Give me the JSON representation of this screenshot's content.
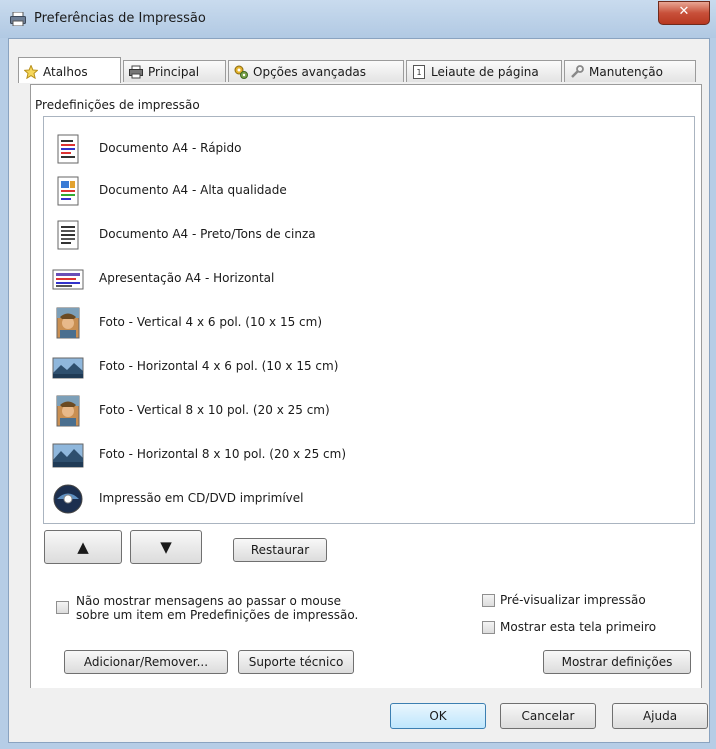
{
  "window": {
    "title": "Preferências de Impressão",
    "close_symbol": "✕"
  },
  "tabs": [
    {
      "label": "Atalhos",
      "icon": "star-icon"
    },
    {
      "label": "Principal",
      "icon": "printer-icon"
    },
    {
      "label": "Opções avançadas",
      "icon": "gears-icon"
    },
    {
      "label": "Leiaute de página",
      "icon": "page-layout-icon"
    },
    {
      "label": "Manutenção",
      "icon": "wrench-icon"
    }
  ],
  "presets": {
    "label": "Predefinições de impressão",
    "items": [
      {
        "label": "Documento A4 - Rápido",
        "icon": "document-fast-icon"
      },
      {
        "label": "Documento A4 - Alta qualidade",
        "icon": "document-quality-icon"
      },
      {
        "label": "Documento A4 - Preto/Tons de cinza",
        "icon": "document-grayscale-icon"
      },
      {
        "label": "Apresentação A4 - Horizontal",
        "icon": "presentation-landscape-icon"
      },
      {
        "label": "Foto - Vertical 4 x 6 pol. (10 x 15 cm)",
        "icon": "photo-portrait-icon"
      },
      {
        "label": "Foto - Horizontal 4 x 6 pol. (10 x 15 cm)",
        "icon": "photo-landscape-icon"
      },
      {
        "label": "Foto - Vertical 8 x 10 pol. (20 x 25 cm)",
        "icon": "photo-portrait-icon"
      },
      {
        "label": "Foto - Horizontal 8 x 10 pol. (20 x 25 cm)",
        "icon": "photo-landscape-icon"
      },
      {
        "label": "Impressão em CD/DVD imprimível",
        "icon": "cd-dvd-icon"
      }
    ]
  },
  "controls": {
    "move_up": "▲",
    "move_down": "▼",
    "restore": "Restaurar",
    "hide_tips_line1": "Não mostrar mensagens ao passar o mouse",
    "hide_tips_line2": "sobre um item em Predefinições de impressão.",
    "preview": "Pré-visualizar impressão",
    "show_first": "Mostrar esta tela primeiro",
    "add_remove": "Adicionar/Remover...",
    "tech_support": "Suporte técnico",
    "show_settings": "Mostrar definições"
  },
  "dialog": {
    "ok": "OK",
    "cancel": "Cancelar",
    "help": "Ajuda"
  }
}
